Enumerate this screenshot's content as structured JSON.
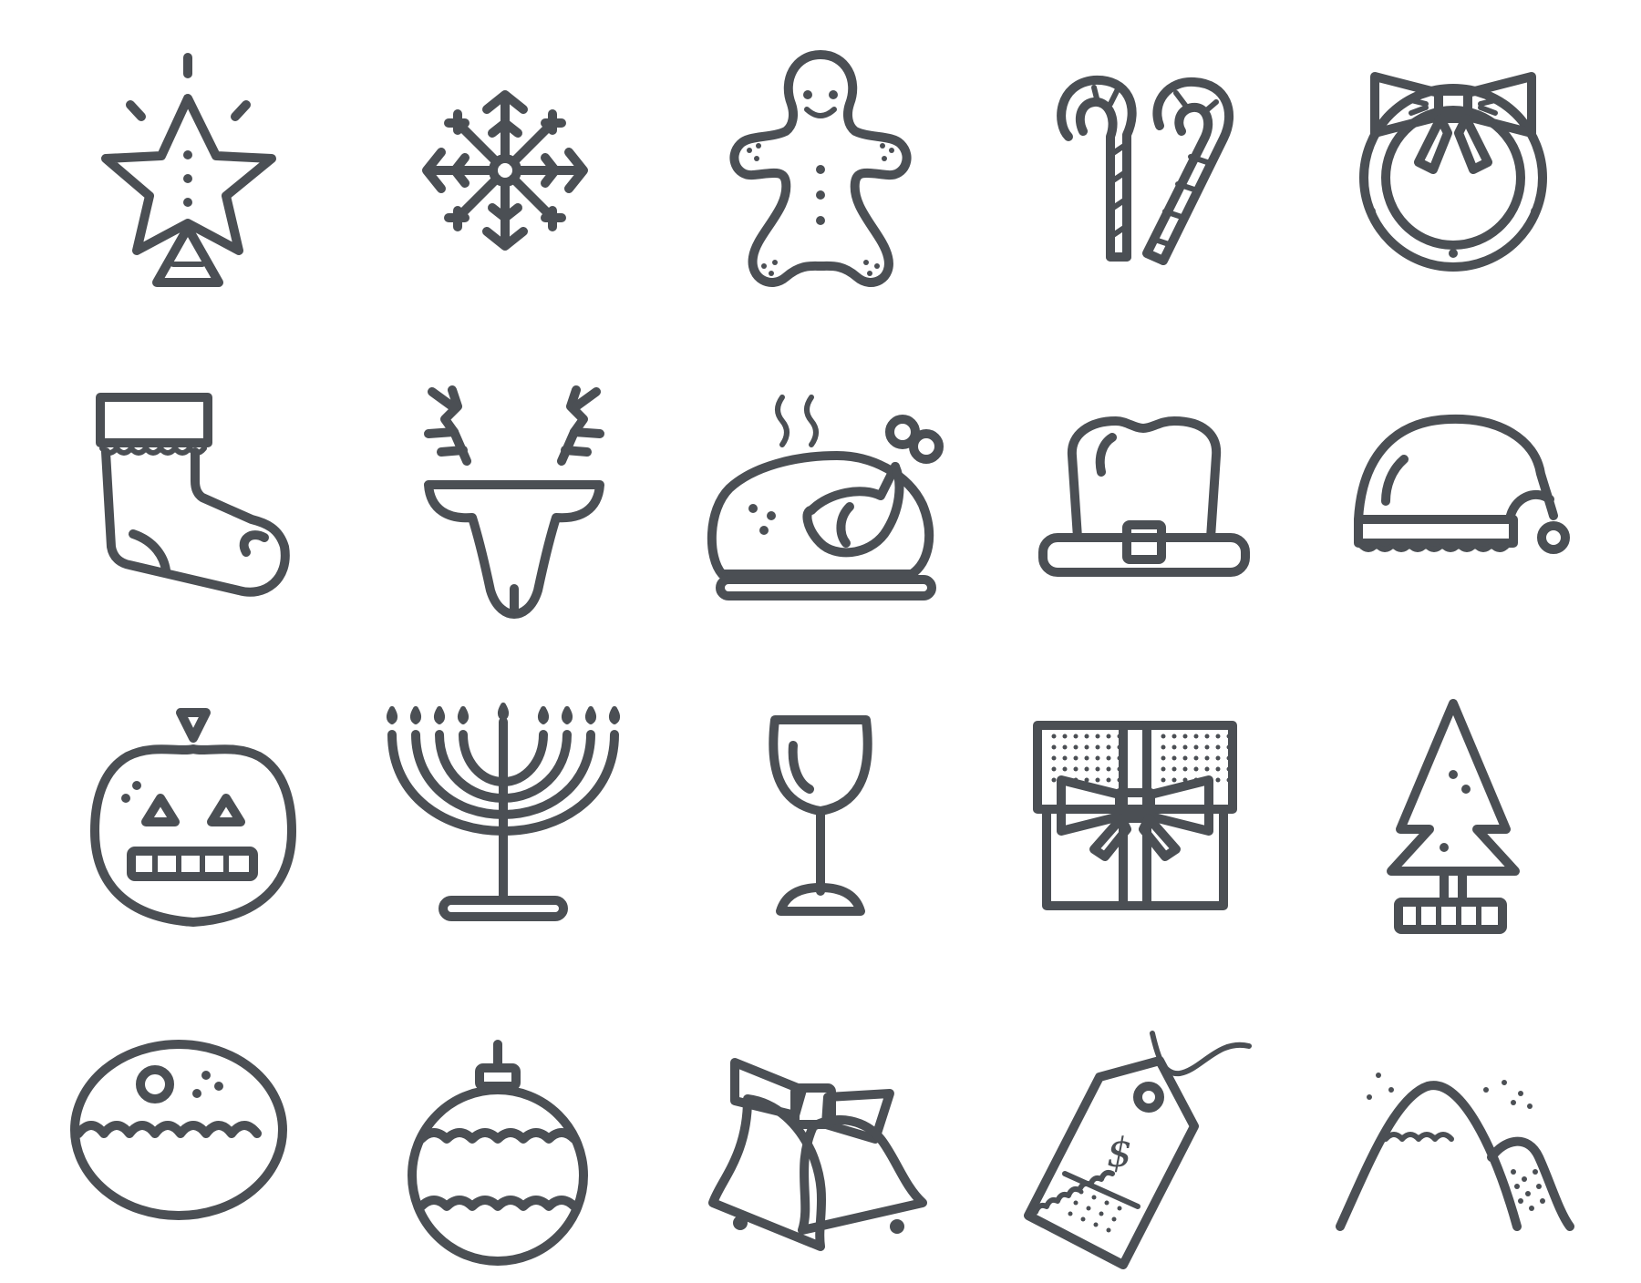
{
  "icons": [
    {
      "name": "tree-star-topper-icon"
    },
    {
      "name": "snowflake-icon"
    },
    {
      "name": "gingerbread-man-icon"
    },
    {
      "name": "candy-canes-icon"
    },
    {
      "name": "wreath-with-bow-icon"
    },
    {
      "name": "christmas-stocking-icon"
    },
    {
      "name": "reindeer-head-icon"
    },
    {
      "name": "roast-turkey-icon"
    },
    {
      "name": "pilgrim-hat-icon"
    },
    {
      "name": "santa-hat-icon"
    },
    {
      "name": "jack-o-lantern-icon"
    },
    {
      "name": "menorah-icon"
    },
    {
      "name": "wine-glass-icon"
    },
    {
      "name": "gift-box-icon"
    },
    {
      "name": "christmas-tree-icon"
    },
    {
      "name": "sufganiyah-donut-icon"
    },
    {
      "name": "christmas-ornament-icon"
    },
    {
      "name": "jingle-bells-icon"
    },
    {
      "name": "price-tag-icon"
    },
    {
      "name": "snowy-mountains-icon"
    }
  ],
  "price_tag": {
    "symbol": "$"
  },
  "colors": {
    "stroke": "#4b4f54",
    "background": "#ffffff"
  }
}
